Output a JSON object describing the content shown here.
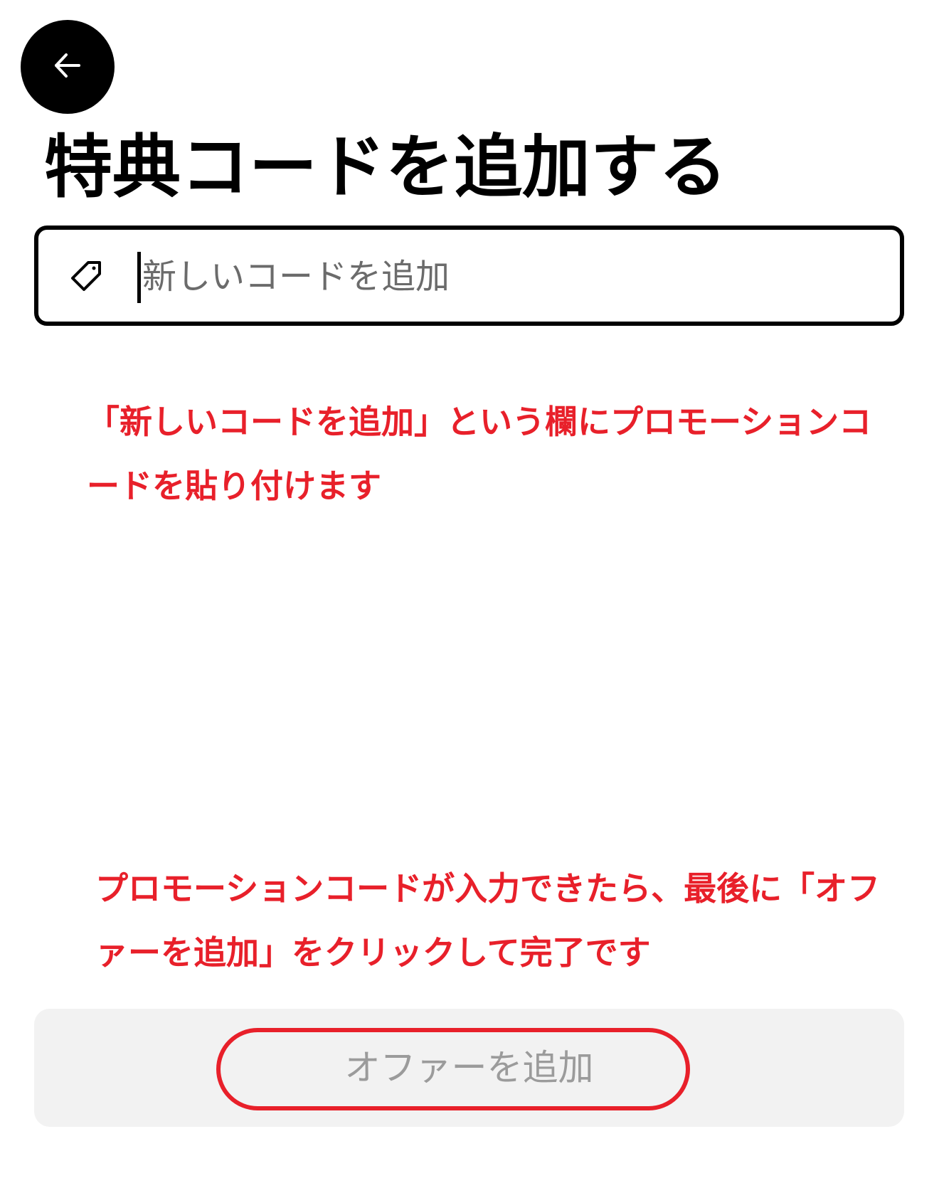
{
  "header": {
    "back_icon": "arrow-left-icon",
    "title": "特典コードを追加する"
  },
  "code_field": {
    "icon": "tag-icon",
    "value": "",
    "placeholder": "新しいコードを追加"
  },
  "annotations": [
    "「新しいコードを追加」という欄にプロモーションコードを貼り付けます",
    "プロモーションコードが入力できたら、最後に「オファーを追加」をクリックして完了です"
  ],
  "offer_button": {
    "label": "オファーを追加"
  },
  "colors": {
    "annotation_red": "#e8202a",
    "highlight_red": "#e8202a",
    "button_bg": "#f2f2f2",
    "button_text_disabled": "#9b9b9b",
    "border_black": "#000000"
  }
}
